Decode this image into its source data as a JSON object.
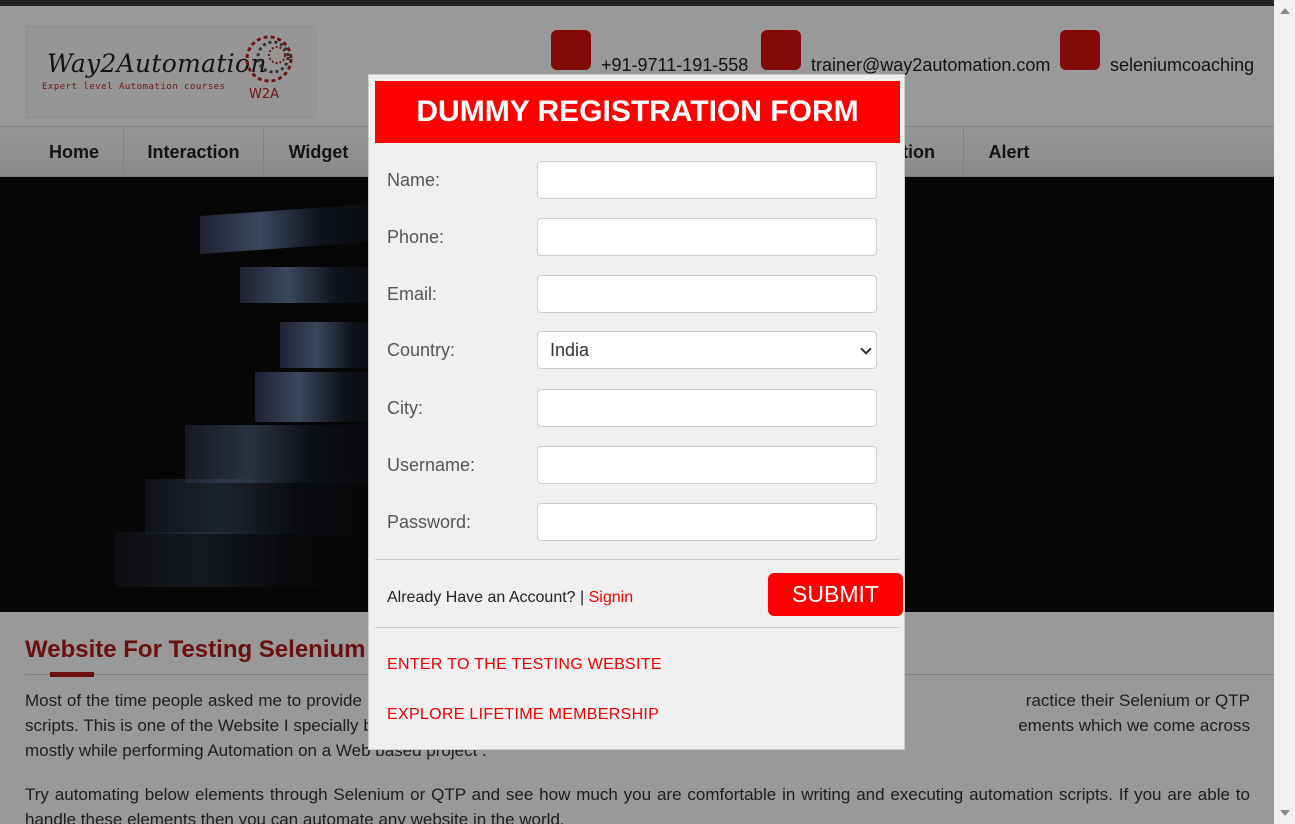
{
  "header": {
    "logo_title": "Way2Automation",
    "logo_subtitle": "Expert level Automation courses",
    "logo_mark_text": "W2A",
    "phone": "+91-9711-191-558",
    "email": "trainer@way2automation.com",
    "skype": "seleniumcoaching"
  },
  "nav": {
    "items": [
      "Home",
      "Interaction",
      "Widget",
      "",
      "tion",
      "Alert"
    ]
  },
  "content": {
    "title": "Website For Testing Selenium",
    "para1": "Most of the time people asked me to provide                                                                                                                                    ractice their Selenium or QTP scripts. This is one of the Website I specially built which c                                                                                                                     ements which we come across mostly while performing Automation on a Web based project .",
    "para2": "Try automating below elements through Selenium or QTP and see how much you are comfortable in writing and executing automation scripts. If you are able to handle these elements then you can automate any website in the world."
  },
  "modal": {
    "title": "DUMMY REGISTRATION FORM",
    "fields": [
      {
        "label": "Name:",
        "value": ""
      },
      {
        "label": "Phone:",
        "value": ""
      },
      {
        "label": "Email:",
        "value": ""
      },
      {
        "label": "Country:",
        "value": "India"
      },
      {
        "label": "City:",
        "value": ""
      },
      {
        "label": "Username:",
        "value": ""
      },
      {
        "label": "Password:",
        "value": ""
      }
    ],
    "already_text": "Already Have an Account? |",
    "signin_label": "Signin",
    "submit_label": "SUBMIT",
    "link1": "ENTER TO THE TESTING WEBSITE",
    "link2": "EXPLORE LIFETIME MEMBERSHIP"
  },
  "colors": {
    "accent_red": "#ff0000",
    "title_red": "#b31b1b"
  }
}
